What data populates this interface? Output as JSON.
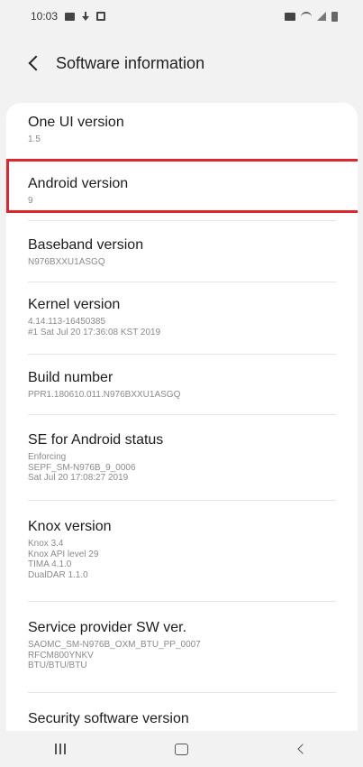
{
  "status_bar": {
    "time": "10:03",
    "icons": [
      "gallery-icon",
      "download-icon",
      "frame-icon",
      "mute-icon",
      "wifi-icon",
      "signal-icon",
      "battery-icon"
    ]
  },
  "header": {
    "back_icon": "back-chevron-icon",
    "title": "Software information"
  },
  "items": [
    {
      "title": "One UI version",
      "sub": "1.5"
    },
    {
      "title": "Android version",
      "sub": "9"
    },
    {
      "title": "Baseband version",
      "sub": "N976BXXU1ASGQ"
    },
    {
      "title": "Kernel version",
      "sub": "4.14.113-16450385\n#1 Sat Jul 20 17:36:08 KST 2019"
    },
    {
      "title": "Build number",
      "sub": "PPR1.180610.011.N976BXXU1ASGQ"
    },
    {
      "title": "SE for Android status",
      "sub": "Enforcing\nSEPF_SM-N976B_9_0006\nSat Jul 20 17:08:27 2019"
    },
    {
      "title": "Knox version",
      "sub": "Knox 3.4\nKnox API level 29\nTIMA 4.1.0\nDualDAR 1.1.0"
    },
    {
      "title": "Service provider SW ver.",
      "sub": "SAOMC_SM-N976B_OXM_BTU_PP_0007\nRFCM800YNKV\nBTU/BTU/BTU"
    },
    {
      "title": "Security software version",
      "sub": ""
    }
  ],
  "highlight": {
    "item_index": 1,
    "color": "#e0262d"
  },
  "nav_bar": {
    "icons": [
      "recents-icon",
      "home-icon",
      "back-icon"
    ]
  },
  "colors": {
    "background": "#f2f2f2",
    "card": "#ffffff",
    "title_text": "#1c1c1c",
    "sub_text": "#8a8a8a"
  }
}
